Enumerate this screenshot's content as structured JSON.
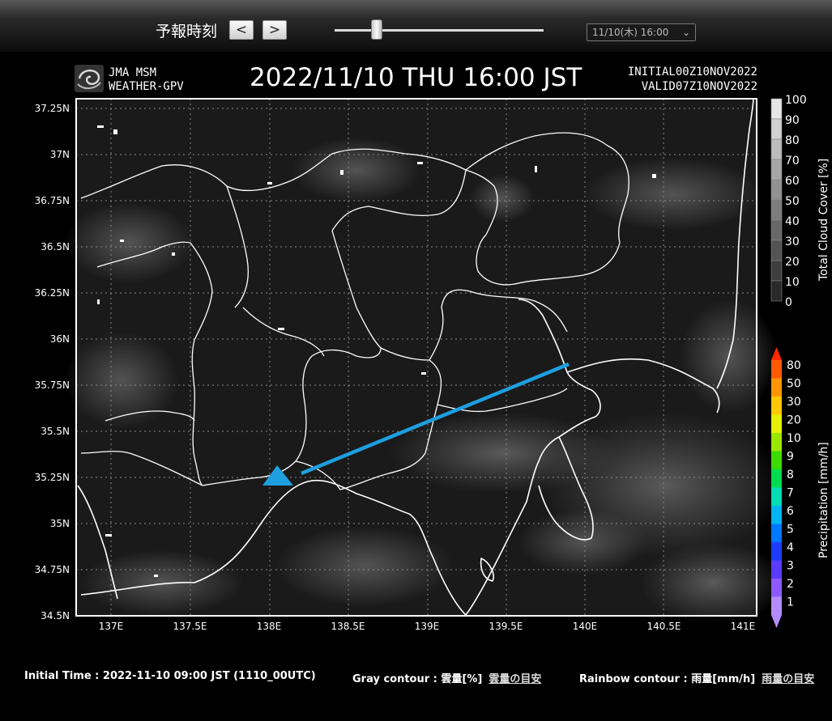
{
  "toolbar": {
    "forecast_time_label": "予報時刻",
    "prev_label": "<",
    "next_label": ">",
    "time_select_value": "11/10(木) 16:00",
    "slider_level": 0.2
  },
  "map": {
    "logo_line1": "JMA MSM",
    "logo_line2": "WEATHER-GPV",
    "datetime": "2022/11/10 THU 16:00 JST",
    "initial": "INITIAL00Z10NOV2022",
    "valid": "VALID07Z10NOV2022",
    "lat_labels": [
      "37.25N",
      "37N",
      "36.75N",
      "36.5N",
      "36.25N",
      "36N",
      "35.75N",
      "35.5N",
      "35.25N",
      "35N",
      "34.75N",
      "34.5N"
    ],
    "lon_labels": [
      "137E",
      "137.5E",
      "138E",
      "138.5E",
      "139E",
      "139.5E",
      "140E",
      "140.5E",
      "141E"
    ],
    "cloud_legend_title": "Total Cloud Cover [%]",
    "cloud_legend_values": [
      "100",
      "90",
      "80",
      "70",
      "60",
      "50",
      "40",
      "30",
      "20",
      "10",
      "0"
    ],
    "precip_legend_title": "Precipitation [mm/h]",
    "precip_legend_values": [
      "80",
      "50",
      "30",
      "20",
      "10",
      "9",
      "8",
      "7",
      "6",
      "5",
      "4",
      "3",
      "2",
      "1"
    ],
    "precip_colors": [
      "#ff2a00",
      "#ff5a00",
      "#ff9500",
      "#ffc800",
      "#e6f000",
      "#9be600",
      "#3cdc00",
      "#00dc50",
      "#00dcb4",
      "#00b4f0",
      "#0078ff",
      "#1e3cff",
      "#5a3cff",
      "#8c5aff",
      "#b48cff"
    ],
    "marker_color": "#1e9fe0"
  },
  "footer": {
    "initial_time": "Initial Time : 2022-11-10 09:00 JST (1110_00UTC)",
    "gray_contour": "Gray contour : 雲量[%]",
    "gray_link": "雲量の目安",
    "rainbow_contour": "Rainbow contour : 雨量[mm/h]",
    "rainbow_link": "雨量の目安"
  }
}
